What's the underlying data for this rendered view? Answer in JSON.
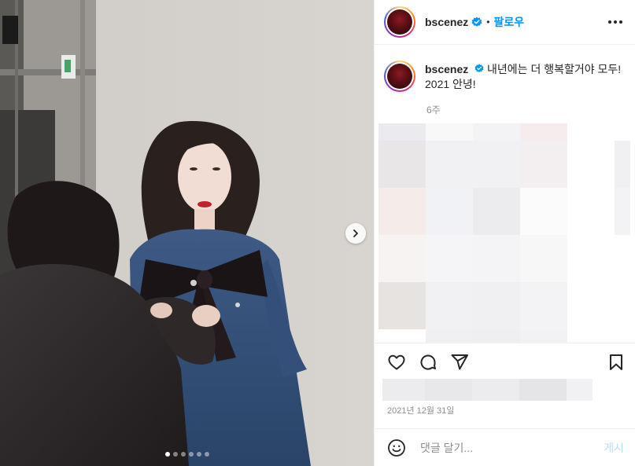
{
  "post": {
    "username": "bscenez",
    "separator": "•",
    "follow_label": "팔로우",
    "caption": "내년에는 더 행복할거야 모두! 2021 안녕!",
    "age": "6주",
    "date": "2021년 12월 31일",
    "carousel": {
      "slide_count": 6,
      "active_index": 0
    }
  },
  "comment": {
    "placeholder": "댓글 달기...",
    "post_label": "게시"
  },
  "colors": {
    "accent": "#0095f6",
    "verified": "#0095f6",
    "muted": "#8e8e8e",
    "post_disabled": "#b2dffc"
  },
  "icons": [
    "verified-badge-icon",
    "more-options-icon",
    "chevron-right-icon",
    "heart-icon",
    "comment-icon",
    "share-icon",
    "bookmark-icon",
    "emoji-icon"
  ]
}
